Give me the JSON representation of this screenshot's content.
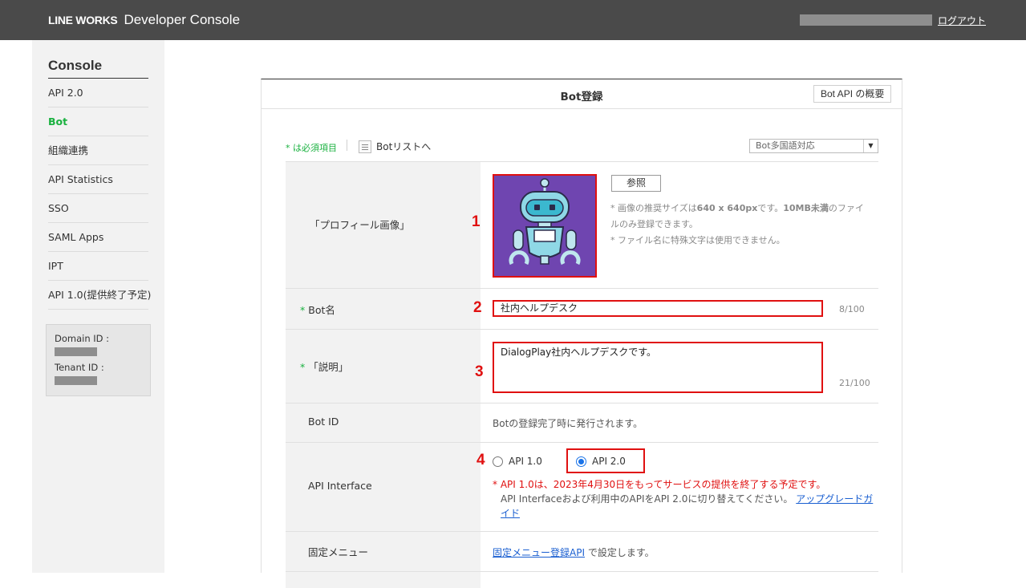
{
  "header": {
    "logo": "LINE WORKS",
    "title": "Developer Console",
    "logout": "ログアウト"
  },
  "sidebar": {
    "title": "Console",
    "items": [
      {
        "label": "API 2.0"
      },
      {
        "label": "Bot"
      },
      {
        "label": "組織連携"
      },
      {
        "label": "API Statistics"
      },
      {
        "label": "SSO"
      },
      {
        "label": "SAML Apps"
      },
      {
        "label": "IPT"
      },
      {
        "label": "API 1.0(提供終了予定)"
      }
    ],
    "active_item": "Bot",
    "domain_label": "Domain ID :",
    "tenant_label": "Tenant ID :"
  },
  "panel": {
    "title": "Bot登録",
    "overview_button": "Bot API の概要",
    "required_note": "* は必須項目",
    "list_link": "Botリストへ",
    "language_select": "Bot多国語対応"
  },
  "form": {
    "profile_image": {
      "label": "「プロフィール画像」",
      "marker": "1",
      "browse_button": "参照",
      "note_1_pre": "* 画像の推奨サイズは",
      "note_1_size": "640 x 640px",
      "note_1_mid": "です。",
      "note_1_limit": "10MB未満",
      "note_1_post": "のファイルのみ登録できます。",
      "note_2": "* ファイル名に特殊文字は使用できません。"
    },
    "bot_name": {
      "label": "Bot名",
      "marker": "2",
      "value": "社内ヘルプデスク",
      "counter": "8/100"
    },
    "description": {
      "label": "「説明」",
      "marker": "3",
      "value": "DialogPlay社内ヘルプデスクです。",
      "counter": "21/100"
    },
    "bot_id": {
      "label": "Bot ID",
      "text": "Botの登録完了時に発行されます。"
    },
    "api_interface": {
      "label": "API Interface",
      "marker": "4",
      "option_1": "API 1.0",
      "option_2": "API 2.0",
      "selected": "API 2.0",
      "warning": "* API 1.0は、2023年4月30日をもってサービスの提供を終了する予定です。",
      "sub_text": "API Interfaceおよび利用中のAPIをAPI 2.0に切り替えてください。",
      "upgrade_link": "アップグレードガイド"
    },
    "fixed_menu": {
      "label": "固定メニュー",
      "link": "固定メニュー登録API",
      "text": " で設定します。"
    }
  },
  "colors": {
    "accent_green": "#19b13f",
    "highlight_red": "#e01010",
    "link_blue": "#1a5fd1",
    "header_bg": "#4a4a4a",
    "avatar_bg": "#6f45b0"
  }
}
